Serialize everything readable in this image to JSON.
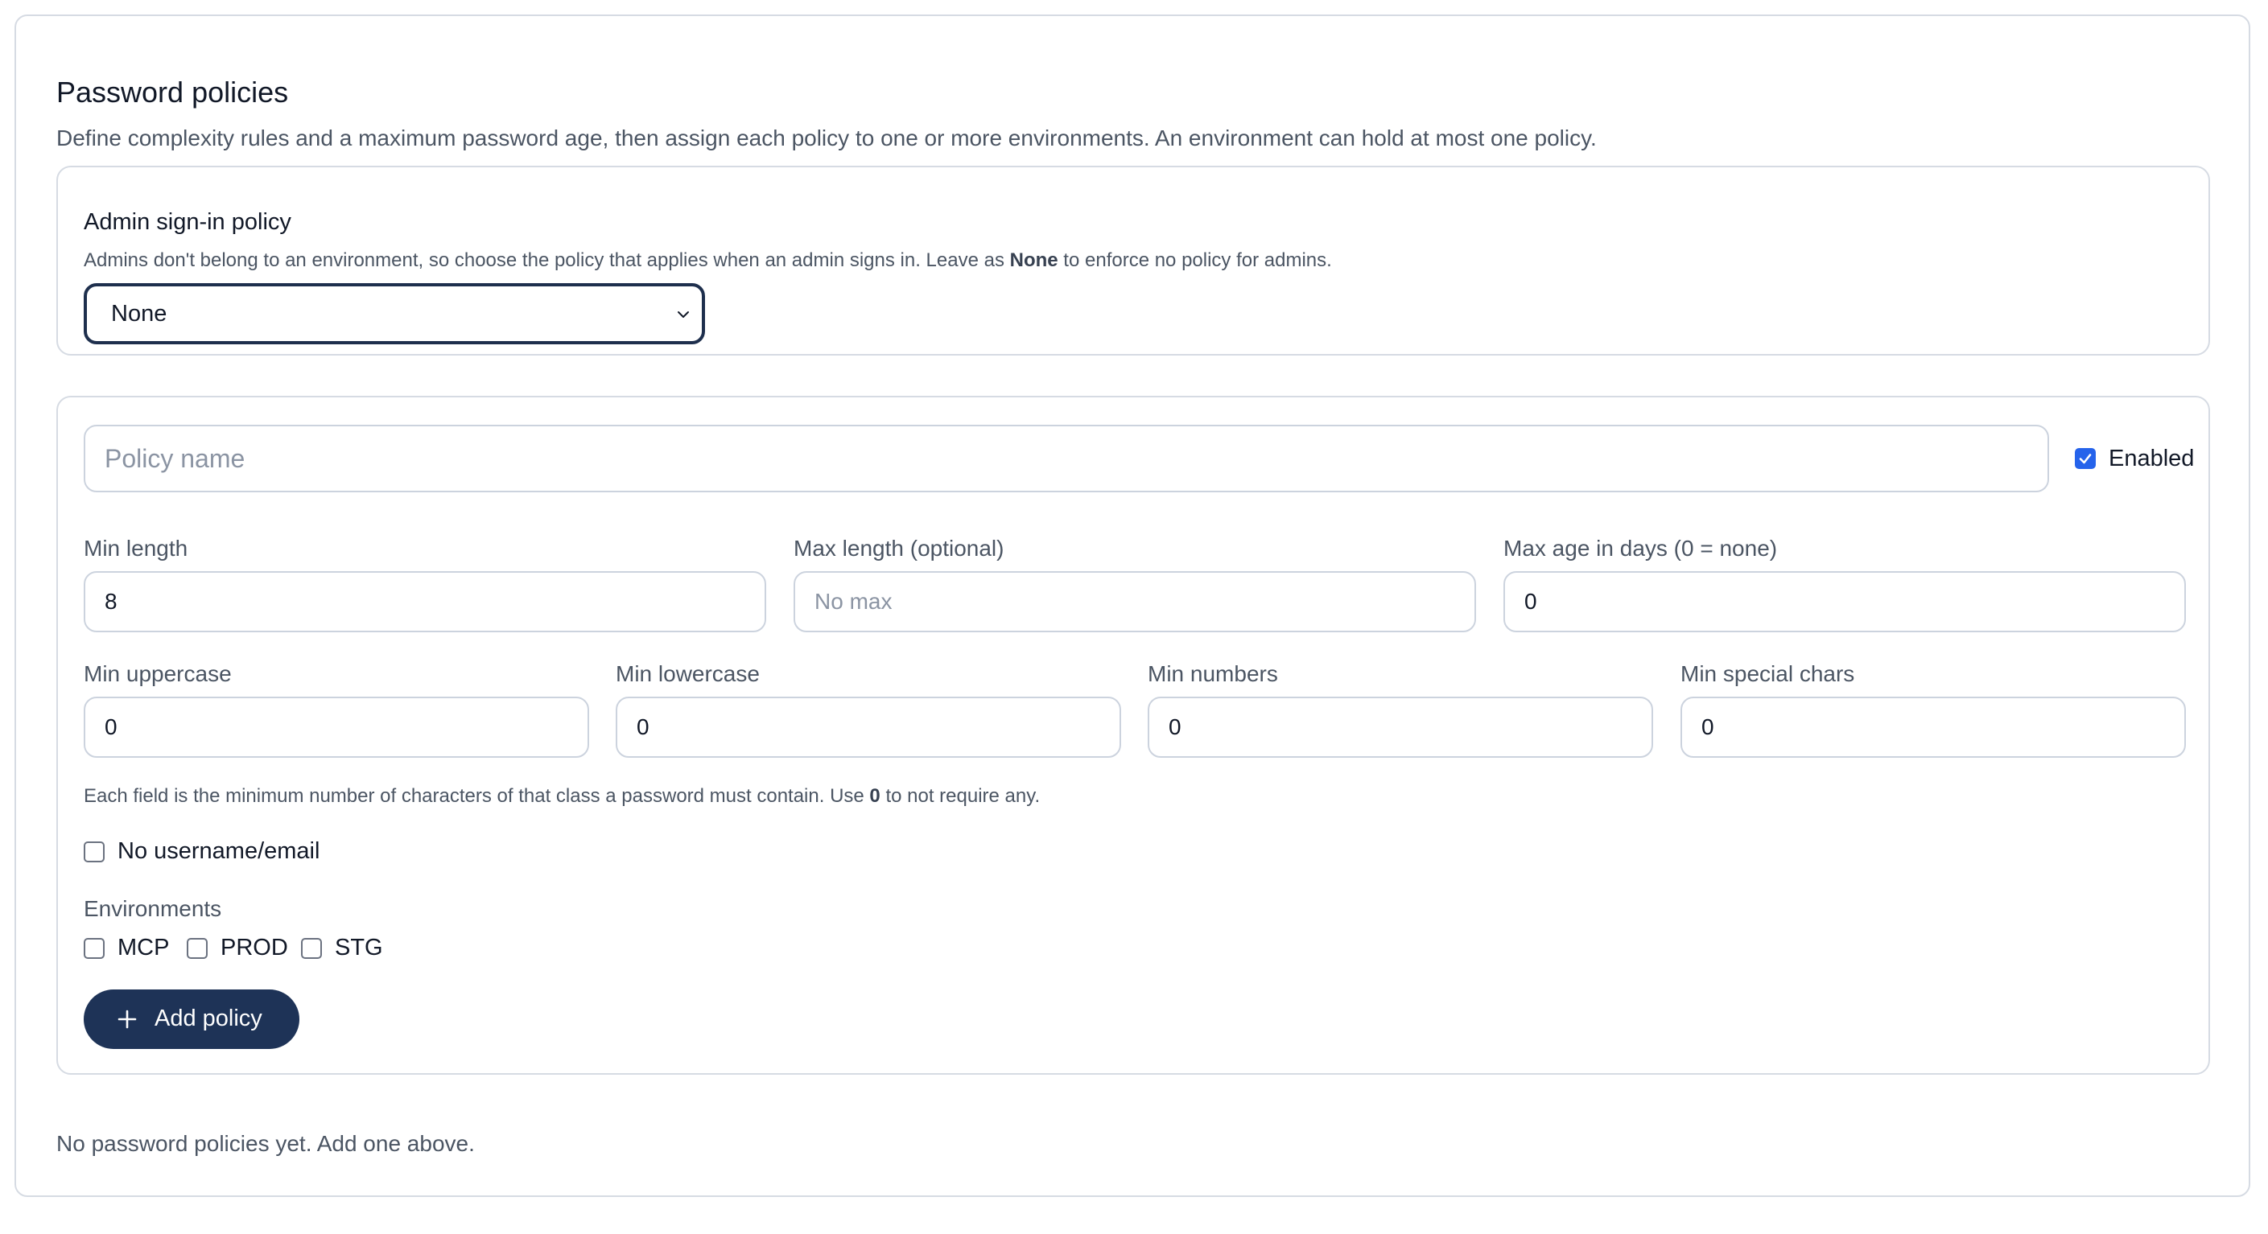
{
  "section": {
    "title": "Password policies",
    "description": "Define complexity rules and a maximum password age, then assign each policy to one or more environments. An environment can hold at most one policy."
  },
  "admin_policy": {
    "title": "Admin sign-in policy",
    "help_prefix": "Admins don't belong to an environment, so choose the policy that applies when an admin signs in. Leave as ",
    "help_bold": "None",
    "help_suffix": " to enforce no policy for admins.",
    "select_value": "None",
    "select_icon": "chevron-down-icon"
  },
  "policy_form": {
    "name_placeholder": "Policy name",
    "enabled_label": "Enabled",
    "enabled_checked": true,
    "min_length": {
      "label": "Min length",
      "value": "8"
    },
    "max_length": {
      "label": "Max length (optional)",
      "placeholder": "No max"
    },
    "max_age": {
      "label": "Max age in days (0 = none)",
      "value": "0"
    },
    "min_uppercase": {
      "label": "Min uppercase",
      "value": "0"
    },
    "min_lowercase": {
      "label": "Min lowercase",
      "value": "0"
    },
    "min_numbers": {
      "label": "Min numbers",
      "value": "0"
    },
    "min_special": {
      "label": "Min special chars",
      "value": "0"
    },
    "class_help_prefix": "Each field is the minimum number of characters of that class a password must contain. Use ",
    "class_help_bold": "0",
    "class_help_suffix": " to not require any.",
    "no_username_label": "No username/email",
    "environments_label": "Environments",
    "environments": [
      "MCP",
      "PROD",
      "STG"
    ],
    "add_button_label": "Add policy",
    "add_button_icon": "plus-icon"
  },
  "empty_message": "No password policies yet. Add one above.",
  "colors": {
    "primary_button": "#1e3357",
    "checkbox_checked": "#2563eb",
    "border": "#d6dbe3"
  }
}
